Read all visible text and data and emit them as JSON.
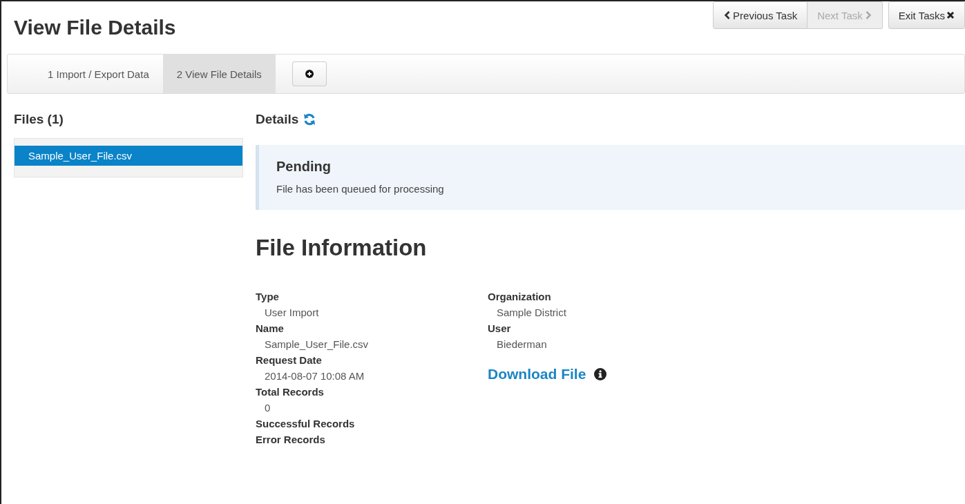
{
  "page": {
    "title": "View File Details"
  },
  "task_buttons": [
    {
      "label": "Previous Task",
      "kind": "prev",
      "disabled": false
    },
    {
      "label": "Next Task",
      "kind": "next",
      "disabled": true
    },
    {
      "label": "Exit Tasks",
      "kind": "exit",
      "disabled": false
    }
  ],
  "steps": [
    {
      "label": "1 Import / Export Data",
      "selected": false
    },
    {
      "label": "2 View File Details",
      "selected": true
    }
  ],
  "files": {
    "heading": "Files (1)",
    "items": [
      {
        "label": "Sample_User_File.csv",
        "selected": true
      }
    ]
  },
  "details": {
    "heading": "Details",
    "status": {
      "title": "Pending",
      "message": "File has been queued for processing"
    },
    "section_title": "File Information",
    "left_fields": [
      {
        "label": "Type",
        "value": "User Import"
      },
      {
        "label": "Name",
        "value": "Sample_User_File.csv"
      },
      {
        "label": "Request Date",
        "value": "2014-08-07 10:08 AM"
      },
      {
        "label": "Total Records",
        "value": "0"
      },
      {
        "label": "Successful Records"
      },
      {
        "label": "Error Records"
      }
    ],
    "right_fields": [
      {
        "label": "Organization",
        "value": "Sample District"
      },
      {
        "label": "User",
        "value": "Biederman"
      }
    ],
    "download_link": "Download File"
  }
}
